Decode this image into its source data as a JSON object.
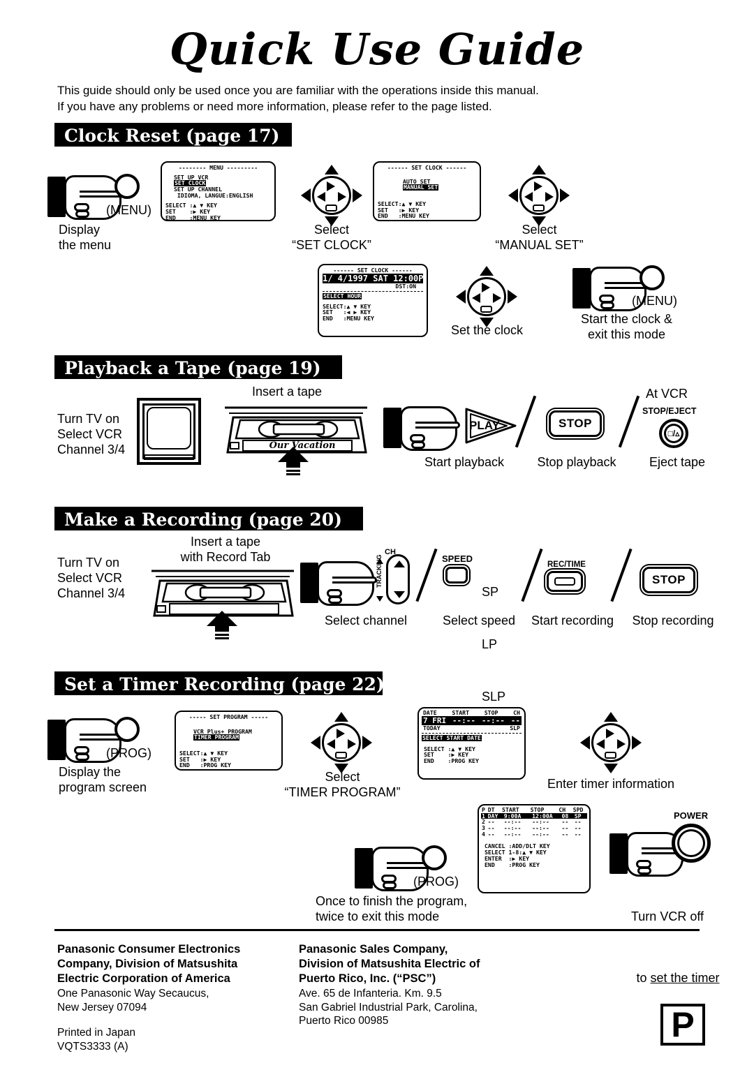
{
  "document": {
    "title": "Quick Use Guide",
    "intro_line1": "This guide should only be used once you are familiar with the operations inside this manual.",
    "intro_line2": "If you have any problems or need more information, please refer to the page listed."
  },
  "sections": {
    "clock": {
      "heading": "Clock Reset (page 17)",
      "step1_button": "(MENU)",
      "step1_caption": "Display\nthe menu",
      "menu_osd": {
        "header": "-------- MENU ---------",
        "items": [
          "SET UP VCR",
          "SET CLOCK",
          "SET UP CHANNEL",
          " IDIOMA, LANGUE:ENGLISH"
        ],
        "highlight": "SET CLOCK",
        "keys": [
          "SELECT :▲ ▼ KEY",
          "SET    :▶ KEY",
          "END    :MENU KEY"
        ]
      },
      "step2_caption": "Select\n“SET CLOCK”",
      "setclock_osd": {
        "header": "------ SET CLOCK ------",
        "items": [
          "AUTO SET",
          "MANUAL SET"
        ],
        "highlight": "MANUAL SET",
        "keys": [
          "SELECT:▲ ▼ KEY",
          "SET   :▶ KEY",
          "END   :MENU KEY"
        ]
      },
      "step3_caption": "Select\n“MANUAL SET”",
      "clockset_osd": {
        "header": "------ SET CLOCK ------",
        "datetime": "1/ 4/1997 SAT 12:00PM",
        "dst": "DST:ON",
        "prompt": "SELECT HOUR",
        "keys": [
          "SELECT:▲ ▼ KEY",
          "SET   :◀ ▶ KEY",
          "END   :MENU KEY"
        ]
      },
      "step4_caption": "Set the clock",
      "step5_button": "(MENU)",
      "step5_caption": "Start the clock &\nexit this mode"
    },
    "playback": {
      "heading": "Playback a Tape (page 19)",
      "tv_caption": "Turn TV on\nSelect VCR\nChannel 3/4",
      "insert_caption": "Insert a tape",
      "tape_label": "Our Vacation",
      "play_button": "PLAY",
      "play_caption": "Start playback",
      "stop_button": "STOP",
      "stop_caption": "Stop playback",
      "at_vcr": "At VCR",
      "eject_button_label": "STOP/EJECT",
      "eject_glyph": "□/▵",
      "eject_caption": "Eject tape"
    },
    "recording": {
      "heading": "Make a Recording (page 20)",
      "tv_caption": "Turn TV on\nSelect VCR\nChannel 3/4",
      "insert_caption": "Insert a tape\nwith Record Tab",
      "ch_label": "CH",
      "tracking_label": "TRACKING",
      "channel_caption": "Select channel",
      "speed_label": "SPEED",
      "speeds": [
        "SP",
        "LP",
        "SLP"
      ],
      "speed_caption": "Select speed",
      "rec_label": "REC/TIME",
      "rec_caption": "Start recording",
      "stop_button": "STOP",
      "stop_caption": "Stop recording"
    },
    "timer": {
      "heading": "Set a Timer Recording (page 22)",
      "step1_button": "(PROG)",
      "step1_caption": "Display the\nprogram screen",
      "program_osd": {
        "header": "----- SET PROGRAM -----",
        "items": [
          "VCR Plus+ PROGRAM",
          "TIMER PROGRAM"
        ],
        "highlight": "TIMER PROGRAM",
        "keys": [
          "SELECT:▲ ▼ KEY",
          "SET   :▶ KEY",
          "END   :PROG KEY"
        ]
      },
      "step2_caption": "Select\n“TIMER PROGRAM”",
      "date_osd": {
        "columns": [
          "DATE",
          "START",
          "STOP",
          "CH"
        ],
        "row": [
          "7 FRI",
          "--:--",
          "--:--",
          "--"
        ],
        "today": "TODAY",
        "speed": "SLP",
        "prompt": "SELECT START DATE",
        "keys": [
          "SELECT :▲ ▼ KEY",
          "SET    :▶ KEY",
          "END    :PROG KEY"
        ]
      },
      "step3_caption": "Enter timer information",
      "step4_button": "(PROG)",
      "step4_caption": "Once to finish the program,\ntwice to exit this mode",
      "list_osd": {
        "columns": [
          "P",
          "DT",
          "START",
          "STOP",
          "CH",
          "SPD"
        ],
        "rows": [
          [
            "1",
            "DAY",
            "9:00A",
            "12:00A",
            "08",
            "SP"
          ],
          [
            "2",
            "--",
            "--:--",
            "--:--",
            "--",
            "--"
          ],
          [
            "3",
            "--",
            "--:--",
            "--:--",
            "--",
            "--"
          ],
          [
            "4",
            "--",
            "--:--",
            "--:--",
            "--",
            "--"
          ]
        ],
        "keys": [
          "CANCEL :ADD/DLT KEY",
          "SELECT 1-8:▲ ▼ KEY",
          "ENTER  :▶ KEY",
          "END    :PROG KEY"
        ]
      },
      "power_label": "POWER",
      "step5_caption_line1": "Turn VCR off",
      "step5_caption_line2a": "to ",
      "step5_caption_line2b": "set the timer"
    }
  },
  "footer": {
    "col1_bold": "Panasonic Consumer Electronics\nCompany, Division of Matsushita\nElectric Corporation of America",
    "col1_plain": "One Panasonic Way Secaucus,\nNew Jersey 07094",
    "col1_print": "Printed in Japan\nVQTS3333  (A)",
    "col2_bold": "Panasonic Sales Company,\nDivision of Matsushita Electric of\nPuerto Rico, Inc. (“PSC”)",
    "col2_plain": "Ave. 65 de Infanteria. Km. 9.5\nSan Gabriel Industrial Park, Carolina,\nPuerto Rico 00985",
    "logo": "P"
  }
}
